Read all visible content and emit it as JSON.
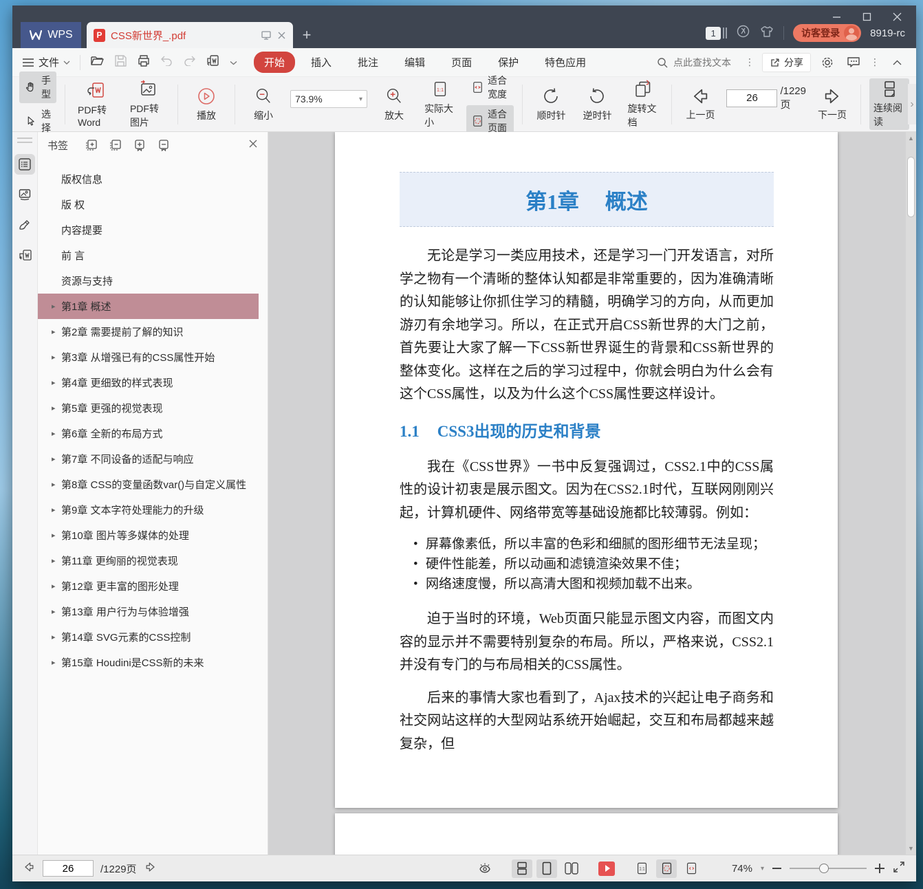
{
  "window": {
    "brand": "WPS",
    "tab_title": "CSS新世界_.pdf",
    "new_tab": "+",
    "window_count": "1",
    "login_label": "访客登录",
    "build": "8919-rc"
  },
  "menu": {
    "file_label": "文件",
    "tabs": [
      {
        "label": "开始",
        "active": true
      },
      {
        "label": "插入"
      },
      {
        "label": "批注"
      },
      {
        "label": "编辑"
      },
      {
        "label": "页面"
      },
      {
        "label": "保护"
      },
      {
        "label": "特色应用"
      }
    ],
    "search_placeholder": "点此查找文本",
    "share_label": "分享"
  },
  "toolbar": {
    "hand": "手型",
    "select": "选择",
    "pdf_to_word": "PDF转Word",
    "pdf_to_image": "PDF转图片",
    "play": "播放",
    "zoom_out": "缩小",
    "zoom_value": "73.9%",
    "zoom_in": "放大",
    "actual_size": "实际大小",
    "fit_width": "适合宽度",
    "fit_page": "适合页面",
    "rotate_cw": "顺时针",
    "rotate_ccw": "逆时针",
    "rotate_doc": "旋转文档",
    "prev_page": "上一页",
    "page_value": "26",
    "page_total": "/1229页",
    "next_page": "下一页",
    "continuous": "连续阅读"
  },
  "sidebar": {
    "title": "书签",
    "items": [
      {
        "label": "版权信息"
      },
      {
        "label": "版 权"
      },
      {
        "label": "内容提要"
      },
      {
        "label": "前 言"
      },
      {
        "label": "资源与支持"
      },
      {
        "label": "第1章 概述",
        "chapter": true,
        "active": true
      },
      {
        "label": "第2章 需要提前了解的知识",
        "chapter": true
      },
      {
        "label": "第3章 从增强已有的CSS属性开始",
        "chapter": true
      },
      {
        "label": "第4章 更细致的样式表现",
        "chapter": true
      },
      {
        "label": "第5章 更强的视觉表现",
        "chapter": true
      },
      {
        "label": "第6章 全新的布局方式",
        "chapter": true
      },
      {
        "label": "第7章 不同设备的适配与响应",
        "chapter": true
      },
      {
        "label": "第8章 CSS的变量函数var()与自定义属性",
        "chapter": true
      },
      {
        "label": "第9章 文本字符处理能力的升级",
        "chapter": true
      },
      {
        "label": "第10章 图片等多媒体的处理",
        "chapter": true
      },
      {
        "label": "第11章 更绚丽的视觉表现",
        "chapter": true
      },
      {
        "label": "第12章 更丰富的图形处理",
        "chapter": true
      },
      {
        "label": "第13章 用户行为与体验增强",
        "chapter": true
      },
      {
        "label": "第14章 SVG元素的CSS控制",
        "chapter": true
      },
      {
        "label": "第15章 Houdini是CSS新的未来",
        "chapter": true
      }
    ]
  },
  "document": {
    "chapter_num": "第1章",
    "chapter_name": "概述",
    "para1": "无论是学习一类应用技术，还是学习一门开发语言，对所学之物有一个清晰的整体认知都是非常重要的，因为准确清晰的认知能够让你抓住学习的精髓，明确学习的方向，从而更加游刃有余地学习。所以，在正式开启CSS新世界的大门之前，首先要让大家了解一下CSS新世界诞生的背景和CSS新世界的整体变化。这样在之后的学习过程中，你就会明白为什么会有这个CSS属性，以及为什么这个CSS属性要这样设计。",
    "section_num": "1.1",
    "section_title": "CSS3出现的历史和背景",
    "para2": "我在《CSS世界》一书中反复强调过，CSS2.1中的CSS属性的设计初衷是展示图文。因为在CSS2.1时代，互联网刚刚兴起，计算机硬件、网络带宽等基础设施都比较薄弱。例如：",
    "bullets": [
      "屏幕像素低，所以丰富的色彩和细腻的图形细节无法呈现；",
      "硬件性能差，所以动画和滤镜渲染效果不佳；",
      "网络速度慢，所以高清大图和视频加载不出来。"
    ],
    "para3": "迫于当时的环境，Web页面只能显示图文内容，而图文内容的显示并不需要特别复杂的布局。所以，严格来说，CSS2.1并没有专门的与布局相关的CSS属性。",
    "para4": "后来的事情大家也看到了，Ajax技术的兴起让电子商务和社交网站这样的大型网站系统开始崛起，交互和布局都越来越复杂，但"
  },
  "statusbar": {
    "page_value": "26",
    "page_total": "/1229页",
    "zoom_value": "74%"
  },
  "colors": {
    "titlebar": "#3e4551",
    "wps_blue": "#46588c",
    "accent_red": "#d2453f",
    "tab_title_red": "#d23b33",
    "pdf_icon_red": "#e23c36",
    "login_pill": "#ed7963",
    "bookmark_highlight": "#c08d96",
    "heading_blue": "#2b80c6",
    "band_bg": "#e9eff9"
  }
}
